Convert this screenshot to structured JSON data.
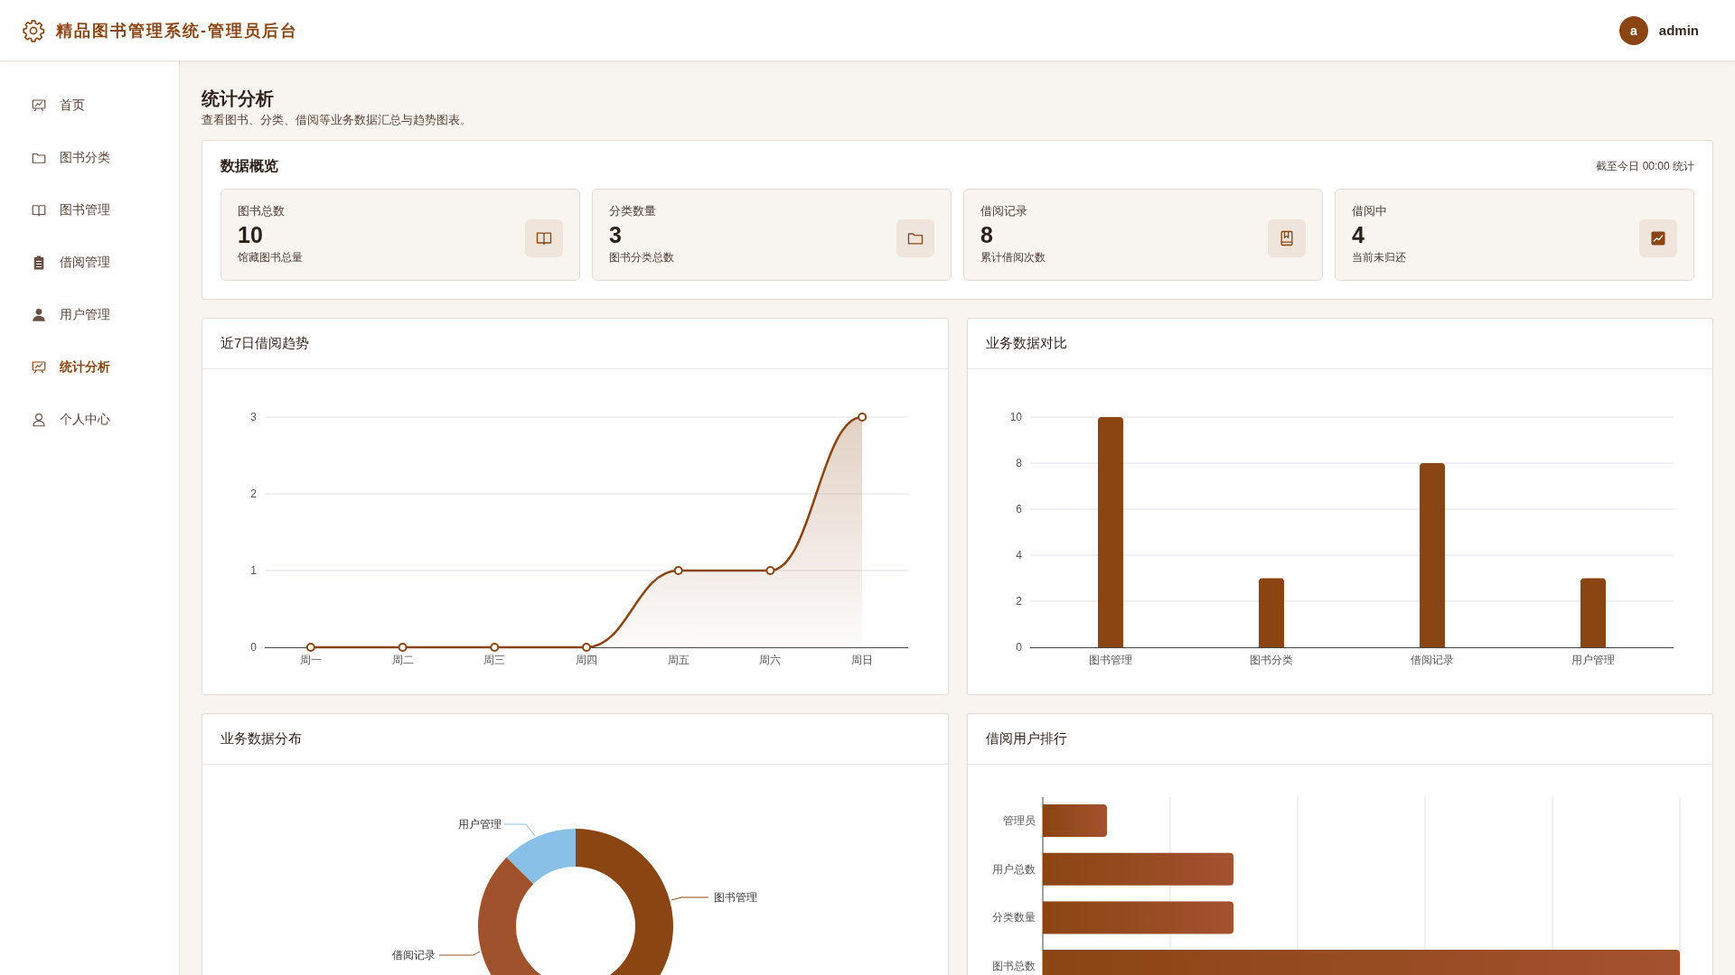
{
  "header": {
    "title": "精品图书管理系统-管理员后台",
    "user": {
      "avatar": "a",
      "name": "admin"
    }
  },
  "sidebar": {
    "items": [
      {
        "label": "首页",
        "selected": false
      },
      {
        "label": "图书分类",
        "selected": false
      },
      {
        "label": "图书管理",
        "selected": false
      },
      {
        "label": "借阅管理",
        "selected": false
      },
      {
        "label": "用户管理",
        "selected": false
      },
      {
        "label": "统计分析",
        "selected": true
      },
      {
        "label": "个人中心",
        "selected": false
      }
    ]
  },
  "page": {
    "title": "统计分析",
    "subtitle": "查看图书、分类、借阅等业务数据汇总与趋势图表。"
  },
  "overview": {
    "title": "数据概览",
    "note": "截至今日 00:00 统计",
    "cards": [
      {
        "label": "图书总数",
        "value": "10",
        "caption": "馆藏图书总量"
      },
      {
        "label": "分类数量",
        "value": "3",
        "caption": "图书分类总数"
      },
      {
        "label": "借阅记录",
        "value": "8",
        "caption": "累计借阅次数"
      },
      {
        "label": "借阅中",
        "value": "4",
        "caption": "当前未归还"
      }
    ]
  },
  "trend": {
    "title": "近7日借阅趋势",
    "chart_data": {
      "type": "line",
      "categories": [
        "周一",
        "周二",
        "周三",
        "周四",
        "周五",
        "周六",
        "周日"
      ],
      "values": [
        0,
        0,
        0,
        0,
        1,
        1,
        3
      ],
      "ylim": [
        0,
        3
      ],
      "yticks": [
        0,
        1,
        2,
        3
      ],
      "marker": true,
      "grid": true
    }
  },
  "comparison": {
    "title": "业务数据对比",
    "chart_data": {
      "type": "bar",
      "categories": [
        "图书管理",
        "图书分类",
        "借阅记录",
        "用户管理"
      ],
      "values": [
        10,
        3,
        8,
        3
      ],
      "ylim": [
        0,
        10
      ],
      "yticks": [
        0,
        2,
        4,
        6,
        8,
        10
      ],
      "grid": true
    }
  },
  "distribution": {
    "title": "业务数据分布",
    "labels": [
      {
        "text": "用户管理",
        "color": "#88c0e8"
      },
      {
        "text": "图书管理",
        "color": "#8b4513"
      },
      {
        "text": "借阅记录",
        "color": "#a0522d"
      }
    ]
  },
  "ranking": {
    "title": "借阅用户排行",
    "rows": [
      {
        "label": "管理员"
      },
      {
        "label": "用户总数"
      },
      {
        "label": "分类数量"
      },
      {
        "label": "图书总数"
      }
    ]
  }
}
